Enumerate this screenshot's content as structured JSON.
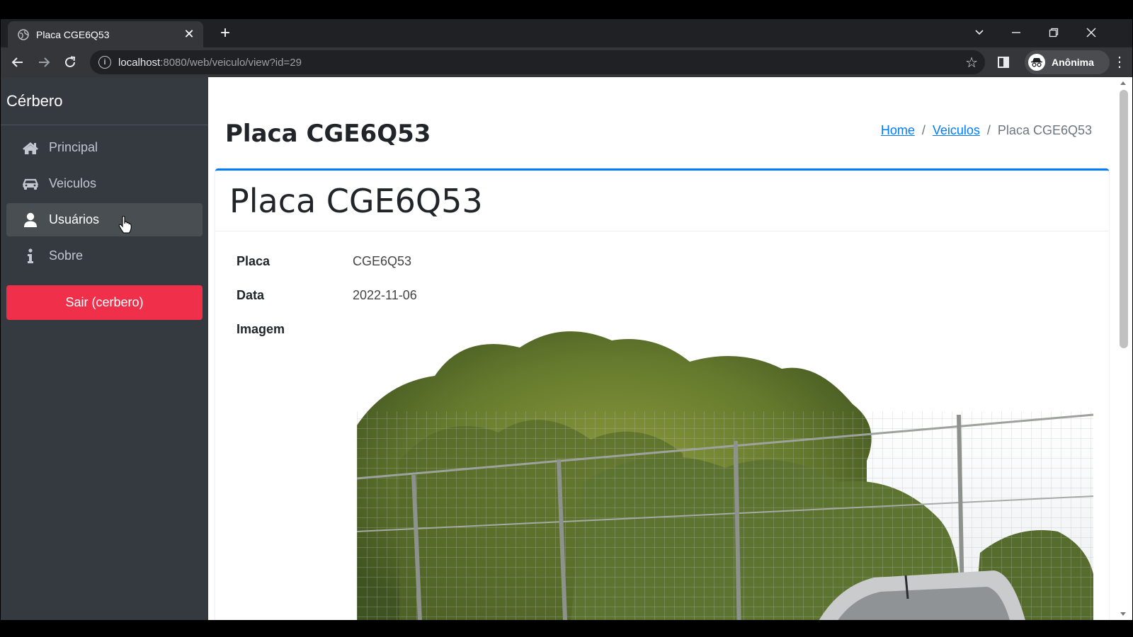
{
  "browser": {
    "tab_title": "Placa CGE6Q53",
    "url_host": "localhost",
    "url_path": ":8080/web/veiculo/view?id=29",
    "profile_label": "Anônima"
  },
  "sidebar": {
    "brand": "Cérbero",
    "items": [
      {
        "label": "Principal",
        "icon": "home-icon"
      },
      {
        "label": "Veiculos",
        "icon": "car-icon"
      },
      {
        "label": "Usuários",
        "icon": "user-icon"
      },
      {
        "label": "Sobre",
        "icon": "info-icon"
      }
    ],
    "logout_label": "Sair (cerbero)"
  },
  "header": {
    "title": "Placa CGE6Q53",
    "breadcrumb": {
      "home": "Home",
      "veiculos": "Veiculos",
      "current": "Placa CGE6Q53",
      "separator": "/"
    }
  },
  "card": {
    "title": "Placa CGE6Q53",
    "details": [
      {
        "label": "Placa",
        "value": "CGE6Q53"
      },
      {
        "label": "Data",
        "value": "2022-11-06"
      },
      {
        "label": "Imagem",
        "value": ""
      }
    ]
  },
  "colors": {
    "sidebar_bg": "#343a40",
    "logout_bg": "#f0304a",
    "card_accent": "#007bff",
    "link": "#007bff"
  }
}
